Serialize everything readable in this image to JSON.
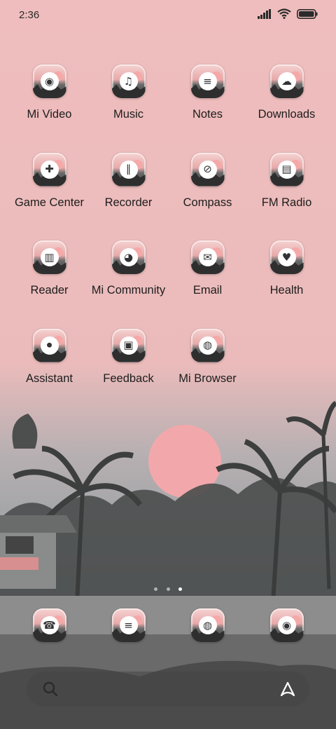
{
  "status": {
    "time": "2:36"
  },
  "apps": [
    {
      "label": "Mi Video",
      "icon": "film-reel-icon",
      "glyph": "◉"
    },
    {
      "label": "Music",
      "icon": "music-note-icon",
      "glyph": "♫"
    },
    {
      "label": "Notes",
      "icon": "notes-icon",
      "glyph": "≡"
    },
    {
      "label": "Downloads",
      "icon": "cloud-download-icon",
      "glyph": "☁"
    },
    {
      "label": "Game Center",
      "icon": "gamepad-icon",
      "glyph": "✚"
    },
    {
      "label": "Recorder",
      "icon": "soundwave-icon",
      "glyph": "∥"
    },
    {
      "label": "Compass",
      "icon": "compass-icon",
      "glyph": "⊘"
    },
    {
      "label": "FM Radio",
      "icon": "radio-icon",
      "glyph": "▤"
    },
    {
      "label": "Reader",
      "icon": "book-icon",
      "glyph": "▥"
    },
    {
      "label": "Mi Community",
      "icon": "chat-face-icon",
      "glyph": "◕"
    },
    {
      "label": "Email",
      "icon": "envelope-icon",
      "glyph": "✉"
    },
    {
      "label": "Health",
      "icon": "heart-plus-icon",
      "glyph": "♥"
    },
    {
      "label": "Assistant",
      "icon": "microphone-icon",
      "glyph": "⏺"
    },
    {
      "label": "Feedback",
      "icon": "briefcase-icon",
      "glyph": "▣"
    },
    {
      "label": "Mi Browser",
      "icon": "planet-icon",
      "glyph": "◍"
    }
  ],
  "dock": [
    {
      "name": "phone",
      "icon": "phone-icon",
      "glyph": "☎"
    },
    {
      "name": "messages",
      "icon": "message-icon",
      "glyph": "≡"
    },
    {
      "name": "browser",
      "icon": "planet-icon",
      "glyph": "◍"
    },
    {
      "name": "camera",
      "icon": "camera-icon",
      "glyph": "◉"
    }
  ],
  "search": {
    "left_icon": "search-icon",
    "right_icon": "assistant-a-icon"
  }
}
